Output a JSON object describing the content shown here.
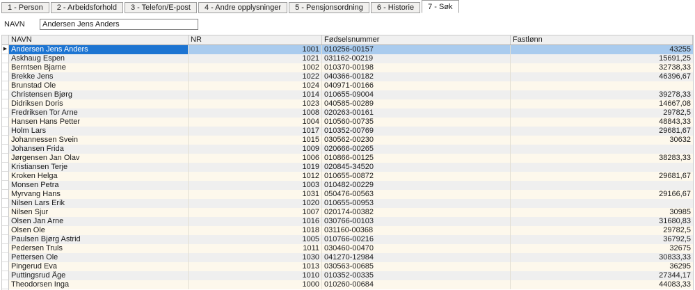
{
  "tabs": [
    {
      "label": "1 - Person",
      "active": false
    },
    {
      "label": "2 - Arbeidsforhold",
      "active": false
    },
    {
      "label": "3 - Telefon/E-post",
      "active": false
    },
    {
      "label": "4 - Andre opplysninger",
      "active": false
    },
    {
      "label": "5 - Pensjonsordning",
      "active": false
    },
    {
      "label": "6 - Historie",
      "active": false
    },
    {
      "label": "7 - Søk",
      "active": true
    }
  ],
  "search": {
    "label": "NAVN",
    "value": "Andersen Jens Anders"
  },
  "table": {
    "columns": {
      "navn": "NAVN",
      "nr": "NR",
      "fnr": "Fødselsnummer",
      "fastlonn": "Fastlønn"
    },
    "selected_row_marker": "▶",
    "rows": [
      {
        "navn": "Andersen Jens Anders",
        "nr": "1001",
        "fnr": "010256-00157",
        "fastlonn": "43255",
        "selected": true
      },
      {
        "navn": "Askhaug Espen",
        "nr": "1021",
        "fnr": "031162-00219",
        "fastlonn": "15691,25"
      },
      {
        "navn": "Berntsen Bjarne",
        "nr": "1002",
        "fnr": "010370-00198",
        "fastlonn": "32738,33"
      },
      {
        "navn": "Brekke Jens",
        "nr": "1022",
        "fnr": "040366-00182",
        "fastlonn": "46396,67"
      },
      {
        "navn": "Brunstad Ole",
        "nr": "1024",
        "fnr": "040971-00166",
        "fastlonn": ""
      },
      {
        "navn": "Christensen Bjørg",
        "nr": "1014",
        "fnr": "010655-09004",
        "fastlonn": "39278,33"
      },
      {
        "navn": "Didriksen Doris",
        "nr": "1023",
        "fnr": "040585-00289",
        "fastlonn": "14667,08"
      },
      {
        "navn": "Fredriksen Tor Arne",
        "nr": "1008",
        "fnr": "020263-00161",
        "fastlonn": "29782,5"
      },
      {
        "navn": "Hansen Hans Petter",
        "nr": "1004",
        "fnr": "010560-00735",
        "fastlonn": "48843,33"
      },
      {
        "navn": "Holm Lars",
        "nr": "1017",
        "fnr": "010352-00769",
        "fastlonn": "29681,67"
      },
      {
        "navn": "Johannessen Svein",
        "nr": "1015",
        "fnr": "030562-00230",
        "fastlonn": "30632"
      },
      {
        "navn": "Johansen Frida",
        "nr": "1009",
        "fnr": "020666-00265",
        "fastlonn": ""
      },
      {
        "navn": "Jørgensen Jan Olav",
        "nr": "1006",
        "fnr": "010866-00125",
        "fastlonn": "38283,33"
      },
      {
        "navn": "Kristiansen Terje",
        "nr": "1019",
        "fnr": "020845-34520",
        "fastlonn": ""
      },
      {
        "navn": "Kroken Helga",
        "nr": "1012",
        "fnr": "010655-00872",
        "fastlonn": "29681,67"
      },
      {
        "navn": "Monsen Petra",
        "nr": "1003",
        "fnr": "010482-00229",
        "fastlonn": ""
      },
      {
        "navn": "Myrvang Hans",
        "nr": "1031",
        "fnr": "050476-00563",
        "fastlonn": "29166,67"
      },
      {
        "navn": "Nilsen Lars Erik",
        "nr": "1020",
        "fnr": "010655-00953",
        "fastlonn": ""
      },
      {
        "navn": "Nilsen Sjur",
        "nr": "1007",
        "fnr": "020174-00382",
        "fastlonn": "30985"
      },
      {
        "navn": "Olsen Jan Arne",
        "nr": "1016",
        "fnr": "030766-00103",
        "fastlonn": "31680,83"
      },
      {
        "navn": "Olsen Ole",
        "nr": "1018",
        "fnr": "031160-00368",
        "fastlonn": "29782,5"
      },
      {
        "navn": "Paulsen Bjørg Astrid",
        "nr": "1005",
        "fnr": "010766-00216",
        "fastlonn": "36792,5"
      },
      {
        "navn": "Pedersen Truls",
        "nr": "1011",
        "fnr": "030460-00470",
        "fastlonn": "32675"
      },
      {
        "navn": "Pettersen Ole",
        "nr": "1030",
        "fnr": "041270-12984",
        "fastlonn": "30833,33"
      },
      {
        "navn": "Pingerud Eva",
        "nr": "1013",
        "fnr": "030563-00685",
        "fastlonn": "36295"
      },
      {
        "navn": "Puttingsrud Åge",
        "nr": "1010",
        "fnr": "010352-00335",
        "fastlonn": "27344,17"
      },
      {
        "navn": "Theodorsen Inga",
        "nr": "1000",
        "fnr": "010260-00684",
        "fastlonn": "44083,33"
      }
    ]
  },
  "colors": {
    "row_odd": "#fdf8ec",
    "row_even": "#efefef",
    "selected_cell": "#1c74d2",
    "selected_row": "#a9cbee",
    "header_bg": "#f0f0f0"
  }
}
